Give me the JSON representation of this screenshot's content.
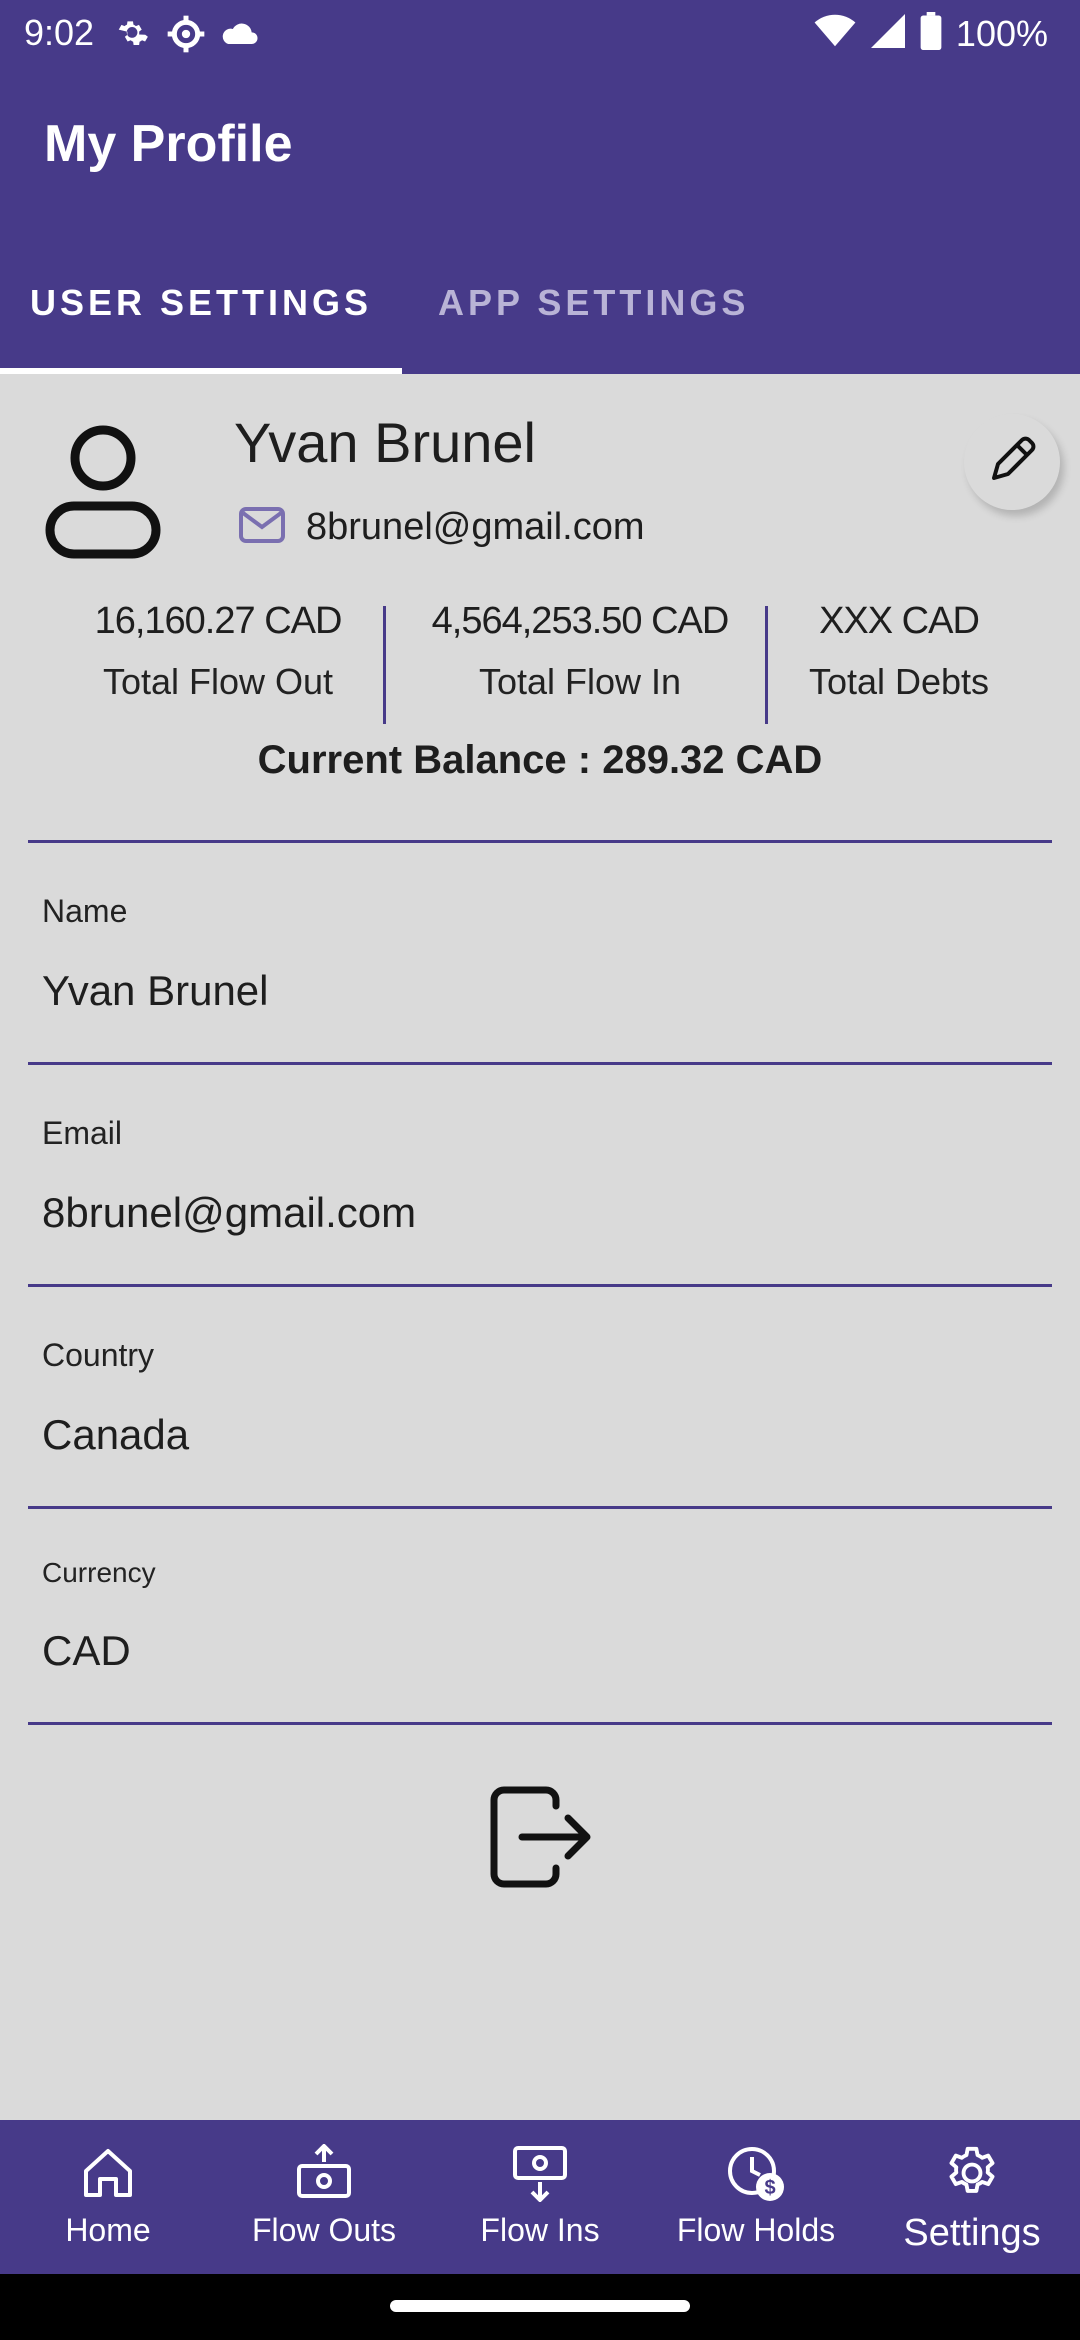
{
  "status_bar": {
    "time": "9:02",
    "battery": "100%",
    "icons": [
      "gear-icon",
      "gear-icon",
      "cloud-icon",
      "wifi-icon",
      "cellular-signal-icon",
      "battery-icon"
    ]
  },
  "app_bar": {
    "title": "My Profile"
  },
  "tabs": [
    {
      "label": "USER SETTINGS",
      "selected": true
    },
    {
      "label": "APP SETTINGS",
      "selected": false
    }
  ],
  "profile": {
    "name": "Yvan Brunel",
    "email": "8brunel@gmail.com",
    "stats": [
      {
        "value": "16,160.27 CAD",
        "label": "Total Flow Out"
      },
      {
        "value": "4,564,253.50 CAD",
        "label": "Total Flow In"
      },
      {
        "value": "XXX CAD",
        "label": "Total Debts"
      }
    ],
    "current_balance": "Current Balance : 289.32 CAD"
  },
  "fields": [
    {
      "label": "Name",
      "value": "Yvan Brunel"
    },
    {
      "label": "Email",
      "value": "8brunel@gmail.com"
    },
    {
      "label": "Country",
      "value": "Canada"
    },
    {
      "label": "Currency",
      "value": "CAD"
    }
  ],
  "bottom_nav": [
    {
      "label": "Home",
      "icon": "home-icon"
    },
    {
      "label": "Flow Outs",
      "icon": "flow-out-icon"
    },
    {
      "label": "Flow Ins",
      "icon": "flow-in-icon"
    },
    {
      "label": "Flow Holds",
      "icon": "flow-hold-icon"
    },
    {
      "label": "Settings",
      "icon": "settings-icon",
      "selected": true
    }
  ],
  "colors": {
    "primary": "#473a89",
    "background": "#dadada",
    "tab_inactive": "#b9b3d6",
    "email_icon": "#7a6fb0"
  }
}
